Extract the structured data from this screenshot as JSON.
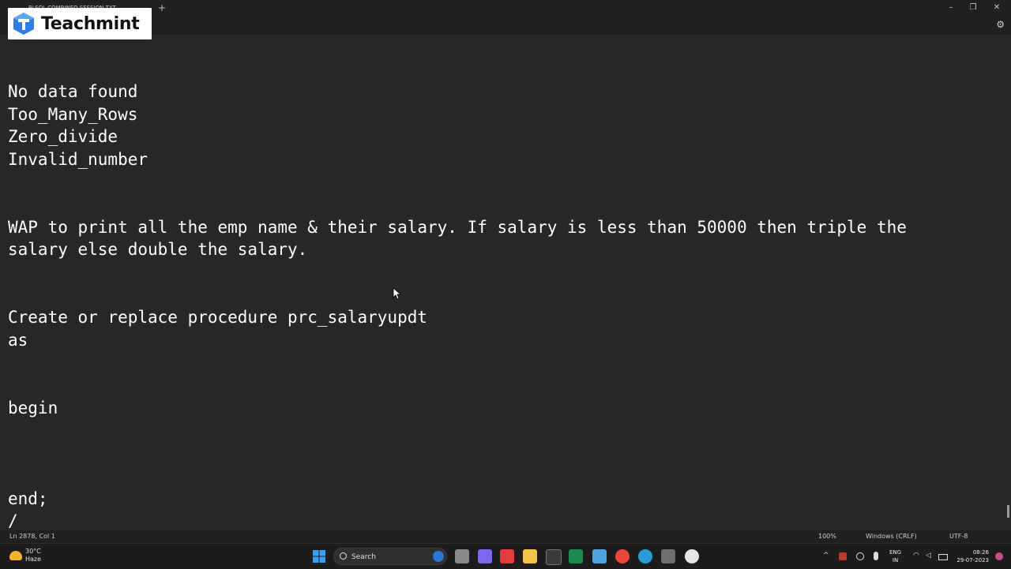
{
  "window": {
    "tab_title": "PLSQL COMBINED SESSION.TXT",
    "new_tab": "+",
    "minimize": "–",
    "maximize": "❐",
    "close": "✕",
    "settings_icon": "gear-icon"
  },
  "overlay": {
    "brand": "Teachmint"
  },
  "editor": {
    "lines": [
      "No data found",
      "Too_Many_Rows",
      "Zero_divide",
      "Invalid_number",
      "WAP to print all the emp name & their salary. If salary is less than 50000 then triple the",
      "salary else double the salary.",
      "Create or replace procedure prc_salaryupdt",
      "as",
      "begin",
      "end;",
      "/"
    ]
  },
  "status": {
    "position": "Ln 2878, Col 1",
    "zoom": "100%",
    "line_ending": "Windows (CRLF)",
    "encoding": "UTF-8"
  },
  "taskbar": {
    "weather_temp": "30°C",
    "weather_desc": "Haze",
    "search_label": "Search",
    "tray_chevron": "^",
    "lang_top": "ENG",
    "lang_bottom": "IN",
    "time": "08:26",
    "date": "29-07-2023",
    "colors": {
      "windows": "#3aa0f3",
      "teams": "#7b68ee",
      "wps": "#e33b3b",
      "explorer": "#f4c34b",
      "excel": "#1d8b4f",
      "notepad": "#4fa3e0",
      "chrome": "#e8453c",
      "edge": "#2b9bd8",
      "calculator": "#6f6f6f"
    }
  }
}
